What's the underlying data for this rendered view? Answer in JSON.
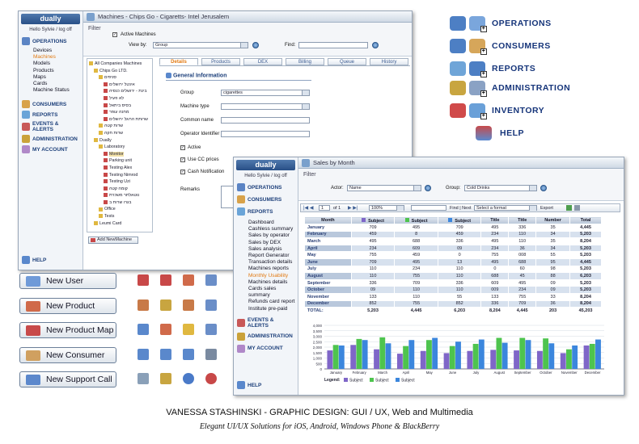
{
  "win1": {
    "logo": "dually",
    "hello": "Hello Sylvie / log off",
    "title": "Machines - Chips Go - Cigaretts- Intel Jerusalem",
    "nav": [
      {
        "label": "OPERATIONS",
        "color": "#5b84c4"
      },
      {
        "label": "CONSUMERS",
        "color": "#d8a24a"
      },
      {
        "label": "REPORTS",
        "color": "#6aa4d8"
      },
      {
        "label": "EVENTS & ALERTS",
        "color": "#c85858"
      },
      {
        "label": "ADMINISTRATION",
        "color": "#caa23a"
      },
      {
        "label": "MY ACCOUNT",
        "color": "#b088c8"
      }
    ],
    "ops_items": [
      "Devices",
      "Machines",
      "Models",
      "Products",
      "Maps",
      "Cards",
      "Machine Status"
    ],
    "help": "HELP",
    "filter": "Filter",
    "active_machines": "Active Machines",
    "view_by": "View by:",
    "view_by_value": "Group",
    "find": "Find:",
    "tree": [
      "All Companies Machines",
      "Chips   Go LTD.",
      "סניפים",
      "אינטל ירושלים",
      "בינת - ירושלים כנסיה",
      "לא פעיל",
      "בסיס ביתאל",
      "מחנה עופר",
      "שרותת הרוגל ירושלים",
      "שרות קטה",
      "שרות חקה",
      "Dually",
      "Laboratory",
      "Monitor",
      "Parking unit",
      "Testing Alex",
      "Testing Nimrod",
      "Testing Uzi",
      "קומה קטה",
      "נוטאלתר משכרת",
      "בגרו שרות ב",
      "Office",
      "Tests",
      "Leumi Card"
    ],
    "tabs": [
      "Details",
      "Products",
      "DEX",
      "Billing",
      "Queue",
      "History"
    ],
    "section": "General Information",
    "group_label": "Group",
    "group_value": "cigarettes",
    "machine_type": "Machine type",
    "common_name": "Common name",
    "operator_id": "Operator Identifier",
    "active": "Active",
    "use_cc": "Use CC prices",
    "cash_notif": "Cash Notification",
    "remarks": "Remarks",
    "add_btn": "Add NewMachine"
  },
  "win2": {
    "logo": "dually",
    "hello": "Hello Sylvie / log off",
    "title": "Sales by Month",
    "nav_top": [
      {
        "label": "OPERATIONS",
        "color": "#5b84c4"
      },
      {
        "label": "CONSUMERS",
        "color": "#d8a24a"
      },
      {
        "label": "REPORTS",
        "color": "#6aa4d8"
      }
    ],
    "reports": [
      "Dashboard",
      "Cashless summary",
      "Sales by operator",
      "Sales by DEX",
      "Sales analysis",
      "Report Generator",
      "Transaction details",
      "Machines reports",
      "Monthly Usability",
      "Machines details",
      "Cards sales summary",
      "Refunds card report",
      "Institute pre-paid"
    ],
    "nav_bottom": [
      {
        "label": "EVENTS & ALERTS",
        "color": "#c85858"
      },
      {
        "label": "ADMINISTRATION",
        "color": "#caa23a"
      },
      {
        "label": "MY ACCOUNT",
        "color": "#b088c8"
      }
    ],
    "help": "HELP",
    "filter": "Filter",
    "actor_label": "Actor:",
    "actor_value": "Name",
    "group_label": "Group:",
    "group_value": "Cold Drinks",
    "pager": {
      "page": "1",
      "of": "of 1",
      "zoom": "100%",
      "find": "Find | Next",
      "format": "Select a format",
      "export": "Export"
    },
    "columns": [
      "Month",
      "Subject",
      "Subject",
      "Subject",
      "Title",
      "Title",
      "Number",
      "Total"
    ],
    "col_colors": [
      "#7f66c8",
      "#4ec44e",
      "#3b86dd"
    ],
    "rows": [
      [
        "January",
        "709",
        "495",
        "709",
        "495",
        "336",
        "35",
        "4,445"
      ],
      [
        "February",
        "459",
        "8",
        "459",
        "234",
        "110",
        "34",
        "5,203"
      ],
      [
        "March",
        "495",
        "688",
        "336",
        "495",
        "110",
        "35",
        "8,204"
      ],
      [
        "April",
        "234",
        "609",
        "09",
        "234",
        "36",
        "34",
        "5,203"
      ],
      [
        "May",
        "755",
        "459",
        "0",
        "755",
        "008",
        "55",
        "5,203"
      ],
      [
        "June",
        "709",
        "495",
        "13",
        "495",
        "688",
        "95",
        "4,445"
      ],
      [
        "July",
        "110",
        "234",
        "110",
        "0",
        "60",
        "98",
        "5,203"
      ],
      [
        "August",
        "110",
        "755",
        "110",
        "688",
        "45",
        "88",
        "6,203"
      ],
      [
        "September",
        "336",
        "709",
        "336",
        "609",
        "495",
        "09",
        "5,203"
      ],
      [
        "October",
        "09",
        "110",
        "110",
        "009",
        "234",
        "09",
        "5,203"
      ],
      [
        "November",
        "133",
        "110",
        "55",
        "133",
        "755",
        "33",
        "8,204"
      ],
      [
        "December",
        "852",
        "755",
        "852",
        "336",
        "709",
        "36",
        "8,204"
      ]
    ],
    "total": [
      "TOTAL:",
      "5,203",
      "4,445",
      "6,203",
      "8,204",
      "4,445",
      "203",
      "45,203"
    ],
    "legend_label": "Legend:"
  },
  "chart_data": {
    "type": "bar",
    "categories": [
      "January",
      "February",
      "March",
      "April",
      "May",
      "June",
      "July",
      "August",
      "September",
      "October",
      "November",
      "December"
    ],
    "ylim": [
      0,
      4000
    ],
    "yticks": [
      "4,000",
      "3,500",
      "3,000",
      "2,500",
      "2,000",
      "1,500",
      "1,000",
      "500",
      "0"
    ],
    "series": [
      {
        "name": "Subject",
        "color": "#7f66c8",
        "values": [
          1700,
          2200,
          1800,
          1400,
          1650,
          1450,
          1650,
          1750,
          1700,
          1650,
          1450,
          2150
        ]
      },
      {
        "name": "Subject",
        "color": "#4ec44e",
        "values": [
          2200,
          2750,
          2900,
          2100,
          2650,
          2100,
          2300,
          2850,
          2850,
          2800,
          1800,
          2300
        ]
      },
      {
        "name": "Subject",
        "color": "#3b86dd",
        "values": [
          2150,
          2650,
          2350,
          2650,
          2850,
          2500,
          2700,
          2400,
          2650,
          2350,
          2150,
          2700
        ]
      }
    ],
    "grid": true,
    "legend_position": "bottom"
  },
  "right_menu": [
    {
      "label": "OPERATIONS",
      "c1": "#4d7fc4",
      "c2": "#7aa6dc"
    },
    {
      "label": "CONSUMERS",
      "c1": "#4d7fc4",
      "c2": "#d6a65a"
    },
    {
      "label": "REPORTS",
      "c1": "#6fa5d8",
      "c2": "#4d7fc4"
    },
    {
      "label": "ADMINISTRATION",
      "c1": "#c8a540",
      "c2": "#8aa2c4"
    },
    {
      "label": "INVENTORY",
      "c1": "#d04a4a",
      "c2": "#6aa0d8"
    },
    {
      "label": "HELP",
      "c1": "#c84a4a",
      "c2": "#5a8ad0"
    }
  ],
  "buttons": [
    "New User",
    "New Product",
    "New Product Map",
    "New Consumer",
    "New Support Call"
  ],
  "button_colors": [
    "#6f9ad8",
    "#d06a4a",
    "#c84a4a",
    "#d0a060",
    "#5c88cc"
  ],
  "grid_icon_colors": [
    [
      "#c84848",
      "#c84848",
      "#d06a4a",
      "#6a8ec8"
    ],
    [
      "#c87a48",
      "#c8a540",
      "#c87a48",
      "#6a8ec8"
    ],
    [
      "#5a88cc",
      "#d06a4a",
      "#e0b840",
      "#6a8ec8"
    ],
    [
      "#5a88cc",
      "#5a88cc",
      "#5a88cc",
      "#7a8aa0"
    ],
    [
      "#8aa0b8",
      "#c8a540",
      "#4a7ac8",
      "#c84848"
    ]
  ],
  "caption_line1": "VANESSA STASHINSKI - GRAPHIC DESIGN: GUI / UX, Web and Multimedia",
  "caption_line2": "Elegant UI/UX Solutions for iOS, Android, Windows Phone & BlackBerry"
}
